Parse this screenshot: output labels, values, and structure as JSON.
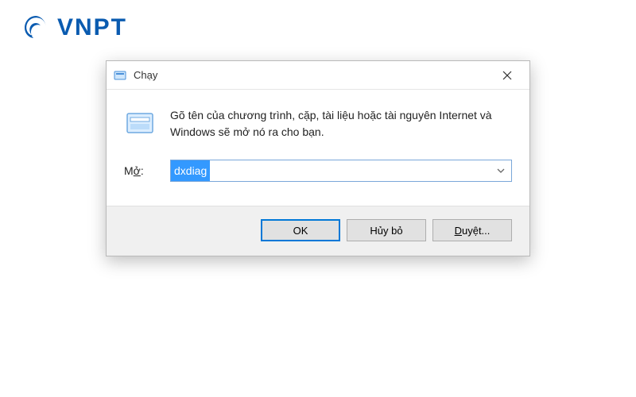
{
  "brand": {
    "text": "VNPT"
  },
  "dialog": {
    "title": "Chạy",
    "description": "Gõ tên của chương trình, cặp, tài liệu hoặc tài nguyên Internet và Windows sẽ mở nó ra cho bạn.",
    "open_label_prefix": "M",
    "open_label_underline": "ở",
    "open_label_suffix": ":",
    "input_value": "dxdiag",
    "selected_text": "dxdiag",
    "buttons": {
      "ok": "OK",
      "cancel": "Hủy bỏ",
      "browse_prefix": "",
      "browse_underline": "D",
      "browse_suffix": "uyệt..."
    }
  },
  "colors": {
    "brand": "#0a5bb0",
    "selection": "#3399ff",
    "focus": "#0078d7"
  }
}
